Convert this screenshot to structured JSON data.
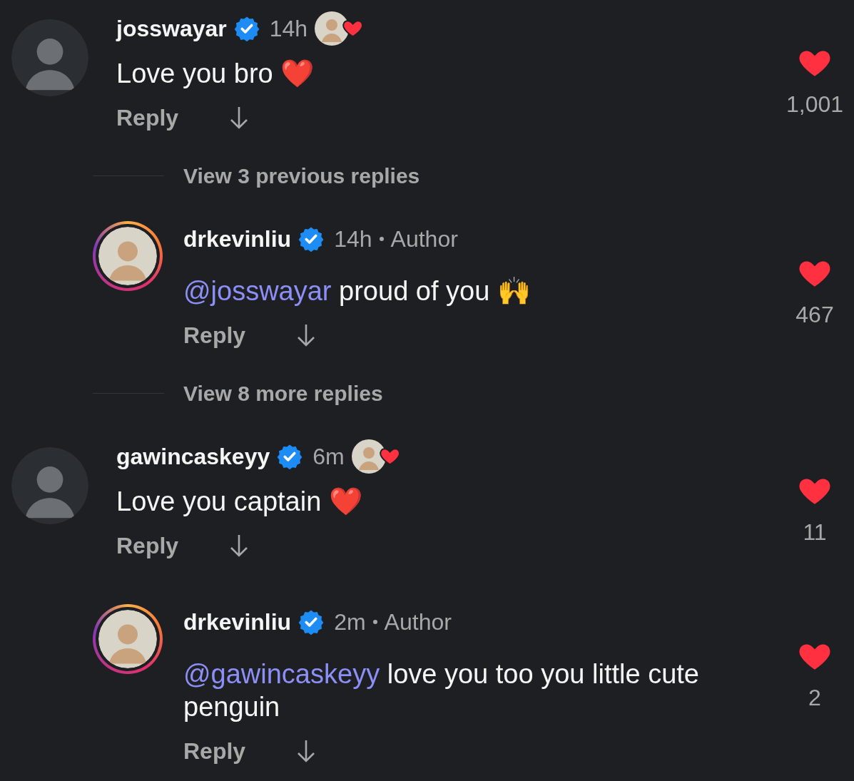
{
  "items": [
    {
      "kind": "comment",
      "username": "josswayar",
      "verified": true,
      "time": "14h",
      "liked_by_author": true,
      "story_ring": false,
      "text": "Love you bro ❤️",
      "reply": "Reply",
      "liked": true,
      "likes": "1,001"
    },
    {
      "kind": "view_replies",
      "label": "View 3 previous replies"
    },
    {
      "kind": "reply",
      "username": "drkevinliu",
      "verified": true,
      "time": "14h",
      "author_label": "Author",
      "liked_by_author": false,
      "story_ring": true,
      "mention": "@josswayar",
      "text": "proud of you 🙌",
      "reply": "Reply",
      "liked": true,
      "likes": "467"
    },
    {
      "kind": "view_replies",
      "label": "View 8 more replies"
    },
    {
      "kind": "comment",
      "username": "gawincaskeyy",
      "verified": true,
      "time": "6m",
      "liked_by_author": true,
      "story_ring": false,
      "text": "Love you captain ❤️",
      "reply": "Reply",
      "liked": true,
      "likes": "11"
    },
    {
      "kind": "reply",
      "username": "drkevinliu",
      "verified": true,
      "time": "2m",
      "author_label": "Author",
      "liked_by_author": false,
      "story_ring": true,
      "mention": "@gawincaskeyy",
      "text": "love you too you little cute penguin",
      "reply": "Reply",
      "liked": true,
      "likes": "2"
    }
  ]
}
